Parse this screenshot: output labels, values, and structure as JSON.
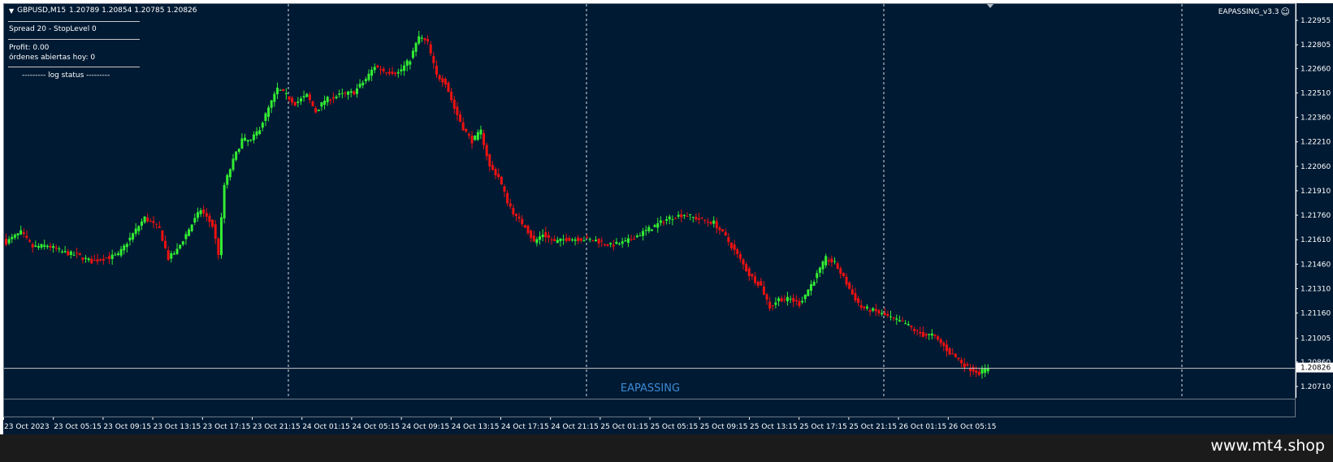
{
  "chart_header": {
    "dropdown_icon": "triangle-down-icon",
    "symbol": "GBPUSD,M15",
    "ohlc": "1.20789 1.20854 1.20785 1.20826"
  },
  "ea_panel": {
    "spread": "Spread 20 - StopLevel 0",
    "profit": "Profit: 0.00",
    "open_orders": "órdenes abiertas hoy: 0",
    "log_status": "--------- log status ---------"
  },
  "ea_name": "EAPASSING_v3.3",
  "ea_icon": "smiley-icon",
  "watermark": "EAPASSING",
  "site_url": "www.mt4.shop",
  "colors": {
    "background": "#001a33",
    "bull": "#33ee33",
    "bear": "#ee1111",
    "grid_separator": "#ffffff",
    "watermark": "#3d8bd4"
  },
  "chart_data": {
    "type": "candlestick",
    "symbol": "GBPUSD",
    "timeframe": "M15",
    "ylim": [
      1.2064,
      1.2306
    ],
    "y_ticks": [
      "1.22955",
      "1.22805",
      "1.22660",
      "1.22510",
      "1.22360",
      "1.22210",
      "1.22060",
      "1.21910",
      "1.21760",
      "1.21610",
      "1.21460",
      "1.21310",
      "1.21160",
      "1.21005",
      "1.20860",
      "1.20710"
    ],
    "current_price": "1.20826",
    "x_ticks": [
      "23 Oct 2023",
      "23 Oct 05:15",
      "23 Oct 09:15",
      "23 Oct 13:15",
      "23 Oct 17:15",
      "23 Oct 21:15",
      "24 Oct 01:15",
      "24 Oct 05:15",
      "24 Oct 09:15",
      "24 Oct 13:15",
      "24 Oct 17:15",
      "24 Oct 21:15",
      "25 Oct 01:15",
      "25 Oct 05:15",
      "25 Oct 09:15",
      "25 Oct 13:15",
      "25 Oct 17:15",
      "25 Oct 21:15",
      "26 Oct 01:15",
      "26 Oct 05:15"
    ],
    "day_separators": [
      "24 Oct 2023",
      "25 Oct 2023",
      "26 Oct 2023",
      "27 Oct 2023"
    ],
    "anchors": [
      [
        0,
        1.216
      ],
      [
        5,
        1.2166
      ],
      [
        9,
        1.2157
      ],
      [
        14,
        1.2158
      ],
      [
        19,
        1.2154
      ],
      [
        24,
        1.2152
      ],
      [
        29,
        1.2148
      ],
      [
        33,
        1.215
      ],
      [
        38,
        1.2152
      ],
      [
        43,
        1.2165
      ],
      [
        47,
        1.2175
      ],
      [
        52,
        1.2168
      ],
      [
        55,
        1.215
      ],
      [
        58,
        1.2155
      ],
      [
        62,
        1.2168
      ],
      [
        66,
        1.218
      ],
      [
        70,
        1.217
      ],
      [
        72,
        1.2153
      ],
      [
        74,
        1.2195
      ],
      [
        77,
        1.221
      ],
      [
        80,
        1.2223
      ],
      [
        83,
        1.2222
      ],
      [
        86,
        1.223
      ],
      [
        89,
        1.2242
      ],
      [
        92,
        1.2254
      ],
      [
        95,
        1.225
      ],
      [
        98,
        1.2245
      ],
      [
        102,
        1.225
      ],
      [
        105,
        1.224
      ],
      [
        108,
        1.2247
      ],
      [
        113,
        1.225
      ],
      [
        118,
        1.2252
      ],
      [
        122,
        1.226
      ],
      [
        125,
        1.2268
      ],
      [
        128,
        1.2265
      ],
      [
        133,
        1.2264
      ],
      [
        137,
        1.2272
      ],
      [
        140,
        1.2286
      ],
      [
        143,
        1.2282
      ],
      [
        146,
        1.2262
      ],
      [
        149,
        1.2258
      ],
      [
        152,
        1.2242
      ],
      [
        155,
        1.223
      ],
      [
        158,
        1.2222
      ],
      [
        161,
        1.2228
      ],
      [
        164,
        1.2206
      ],
      [
        167,
        1.22
      ],
      [
        170,
        1.2185
      ],
      [
        173,
        1.2175
      ],
      [
        176,
        1.217
      ],
      [
        179,
        1.216
      ],
      [
        182,
        1.2165
      ],
      [
        186,
        1.216
      ],
      [
        190,
        1.2162
      ],
      [
        195,
        1.2162
      ],
      [
        200,
        1.2161
      ],
      [
        205,
        1.2158
      ],
      [
        210,
        1.216
      ],
      [
        215,
        1.2165
      ],
      [
        220,
        1.217
      ],
      [
        225,
        1.2175
      ],
      [
        230,
        1.2177
      ],
      [
        235,
        1.2174
      ],
      [
        240,
        1.2172
      ],
      [
        244,
        1.2163
      ],
      [
        248,
        1.2152
      ],
      [
        252,
        1.214
      ],
      [
        256,
        1.2133
      ],
      [
        259,
        1.212
      ],
      [
        262,
        1.2125
      ],
      [
        266,
        1.2125
      ],
      [
        269,
        1.2122
      ],
      [
        272,
        1.2131
      ],
      [
        275,
        1.214
      ],
      [
        278,
        1.215
      ],
      [
        281,
        1.2147
      ],
      [
        284,
        1.2138
      ],
      [
        287,
        1.2128
      ],
      [
        290,
        1.212
      ],
      [
        294,
        1.2118
      ],
      [
        298,
        1.2115
      ],
      [
        302,
        1.2112
      ],
      [
        305,
        1.211
      ],
      [
        308,
        1.2106
      ],
      [
        311,
        1.2103
      ],
      [
        314,
        1.2103
      ],
      [
        317,
        1.2098
      ],
      [
        320,
        1.2092
      ],
      [
        323,
        1.2088
      ],
      [
        326,
        1.2083
      ],
      [
        330,
        1.208
      ],
      [
        333,
        1.2083
      ]
    ]
  }
}
